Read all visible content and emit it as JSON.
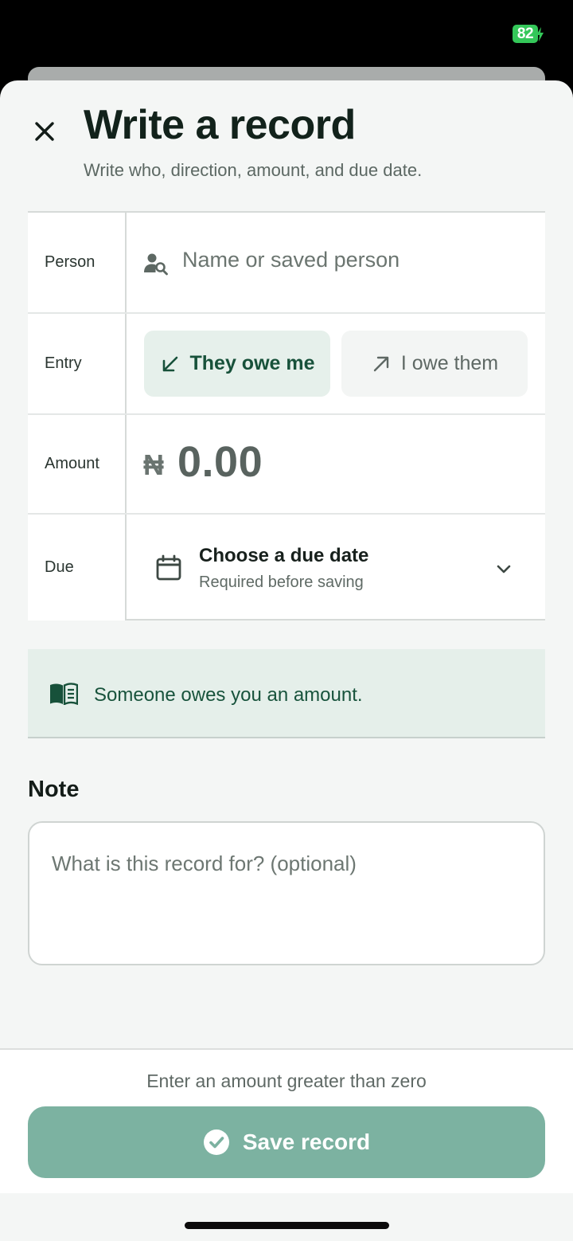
{
  "status_bar": {
    "battery_level": "82",
    "battery_color": "#34c759"
  },
  "header": {
    "close_icon": "close-icon",
    "title": "Write a record",
    "subtitle": "Write who, direction, amount, and due date."
  },
  "form": {
    "person": {
      "label": "Person",
      "placeholder": "Name or saved person",
      "icon": "person-search-icon"
    },
    "entry": {
      "label": "Entry",
      "options": [
        {
          "label": "They owe me",
          "icon": "arrow-down-left-icon",
          "selected": true
        },
        {
          "label": "I owe them",
          "icon": "arrow-up-right-icon",
          "selected": false
        }
      ]
    },
    "amount": {
      "label": "Amount",
      "currency": "₦",
      "value": "0.00"
    },
    "due": {
      "label": "Due",
      "title": "Choose a due date",
      "hint": "Required before saving",
      "icon": "calendar-icon"
    }
  },
  "info_banner": {
    "icon": "book-icon",
    "text": "Someone owes you an amount."
  },
  "note": {
    "label": "Note",
    "placeholder": "What is this record for? (optional)"
  },
  "footer": {
    "hint": "Enter an amount greater than zero",
    "save_label": "Save record",
    "save_icon": "check-circle-icon"
  },
  "colors": {
    "accent": "#17513a",
    "save_button": "#7cb2a1",
    "background": "#f4f6f5"
  }
}
